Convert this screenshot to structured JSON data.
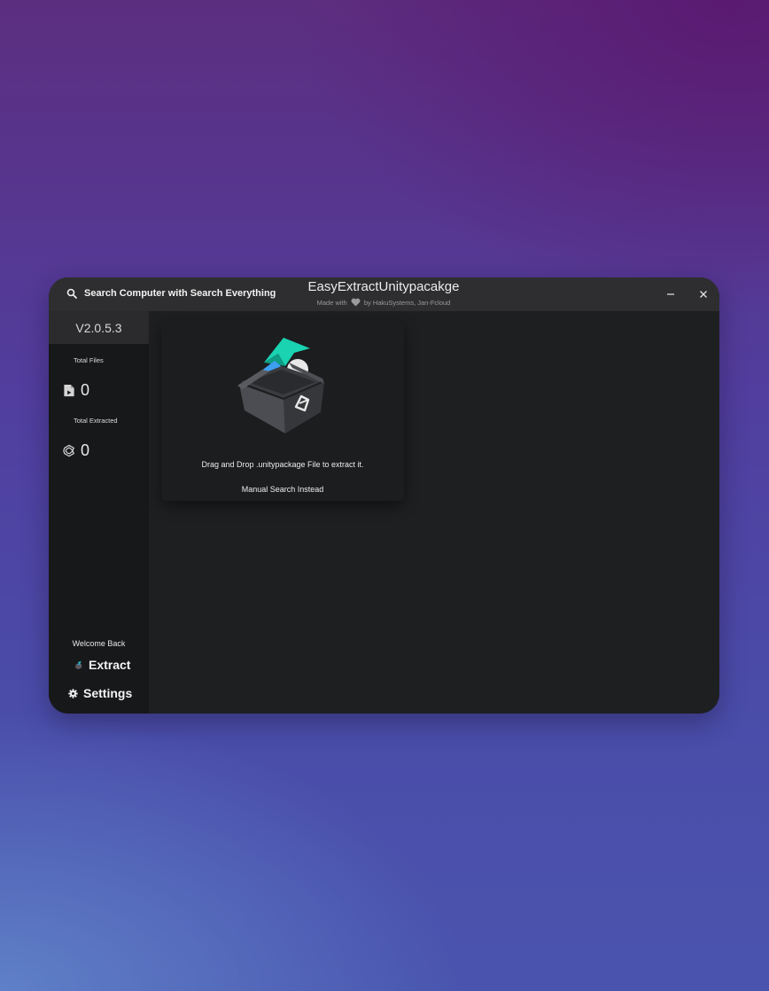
{
  "titlebar": {
    "search_label": "Search Computer with Search Everything",
    "app_title": "EasyExtractUnitypacakge",
    "made_with": "Made with",
    "credits": "by HakuSystems, Jan-Fcloud",
    "heart_icon": "heart-icon",
    "minimize_icon": "minimize-icon",
    "close_icon": "close-icon"
  },
  "sidebar": {
    "version": "V2.0.5.3",
    "total_files_label": "Total Files",
    "total_files_value": "0",
    "total_extracted_label": "Total Extracted",
    "total_extracted_value": "0",
    "welcome": "Welcome Back",
    "nav": [
      {
        "label": "Extract",
        "icon": "extract-icon"
      },
      {
        "label": "Settings",
        "icon": "gear-icon"
      }
    ],
    "footer_icons": [
      "patreon-icon",
      "discord-icon",
      "help-icon"
    ]
  },
  "dropzone": {
    "instruction": "Drag and Drop .unitypackage File to extract it.",
    "manual_link": "Manual Search Instead"
  },
  "colors": {
    "window_bg": "#1e1f21",
    "titlebar_bg": "#2e2e30",
    "sidebar_bg": "#17181a",
    "accent_teal": "#1fd6b8",
    "accent_blue": "#3aa0f0"
  }
}
